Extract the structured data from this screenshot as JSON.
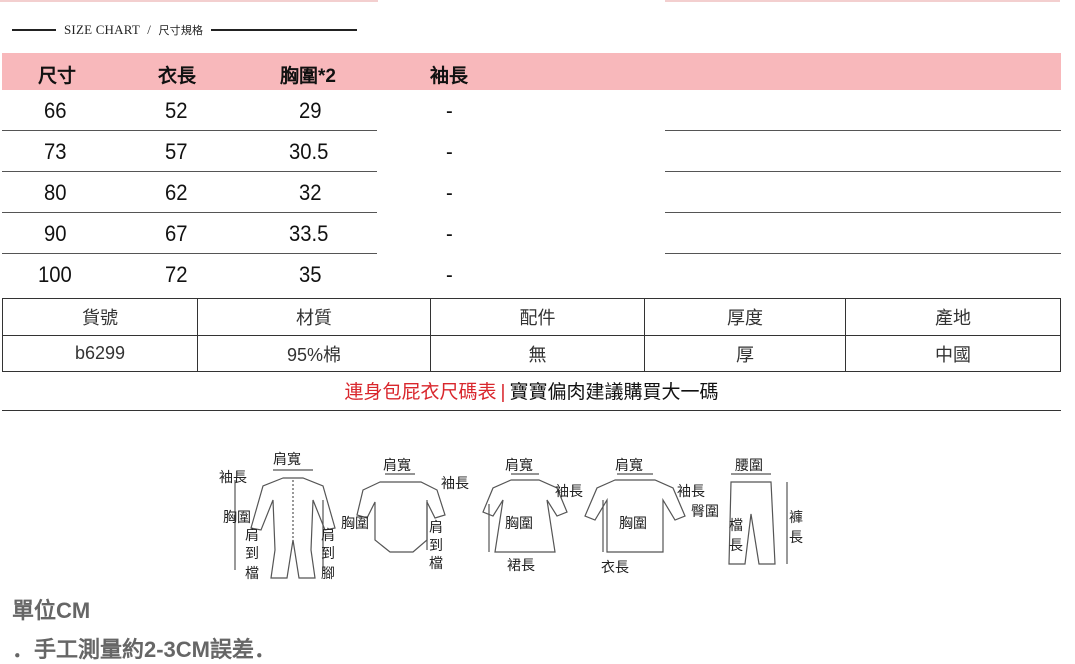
{
  "chart_title": {
    "en": "SIZE CHART",
    "sep": "/",
    "cn": "尺寸規格"
  },
  "size_table": {
    "headers": [
      "尺寸",
      "衣長",
      "胸圍*2",
      "袖長"
    ],
    "rows": [
      [
        "66",
        "52",
        "29",
        "-"
      ],
      [
        "73",
        "57",
        "30.5",
        "-"
      ],
      [
        "80",
        "62",
        "32",
        "-"
      ],
      [
        "90",
        "67",
        "33.5",
        "-"
      ],
      [
        "100",
        "72",
        "35",
        "-"
      ]
    ]
  },
  "product_info": {
    "headers": [
      "貨號",
      "材質",
      "配件",
      "厚度",
      "產地"
    ],
    "values": [
      "b6299",
      "95%棉",
      "無",
      "厚",
      "中國"
    ]
  },
  "note": {
    "highlight": "連身包屁衣尺碼表",
    "sep": "|",
    "text": "寶寶偏肉建議購買大一碼"
  },
  "diagram_labels": {
    "romper": [
      "肩寬",
      "袖長",
      "胸圍",
      "肩",
      "到",
      "檔",
      "肩",
      "到",
      "腳"
    ],
    "bodysuit": [
      "肩寬",
      "袖長",
      "胸圍",
      "肩",
      "到",
      "檔"
    ],
    "dress": [
      "肩寬",
      "袖長",
      "胸圍",
      "裙長"
    ],
    "top": [
      "肩寬",
      "袖長",
      "胸圍",
      "衣長"
    ],
    "pants": [
      "腰圍",
      "臀圍",
      "檔",
      "長",
      "褲",
      "長"
    ]
  },
  "unit": "單位CM",
  "tip": "．手工測量約2-3CM誤差．"
}
